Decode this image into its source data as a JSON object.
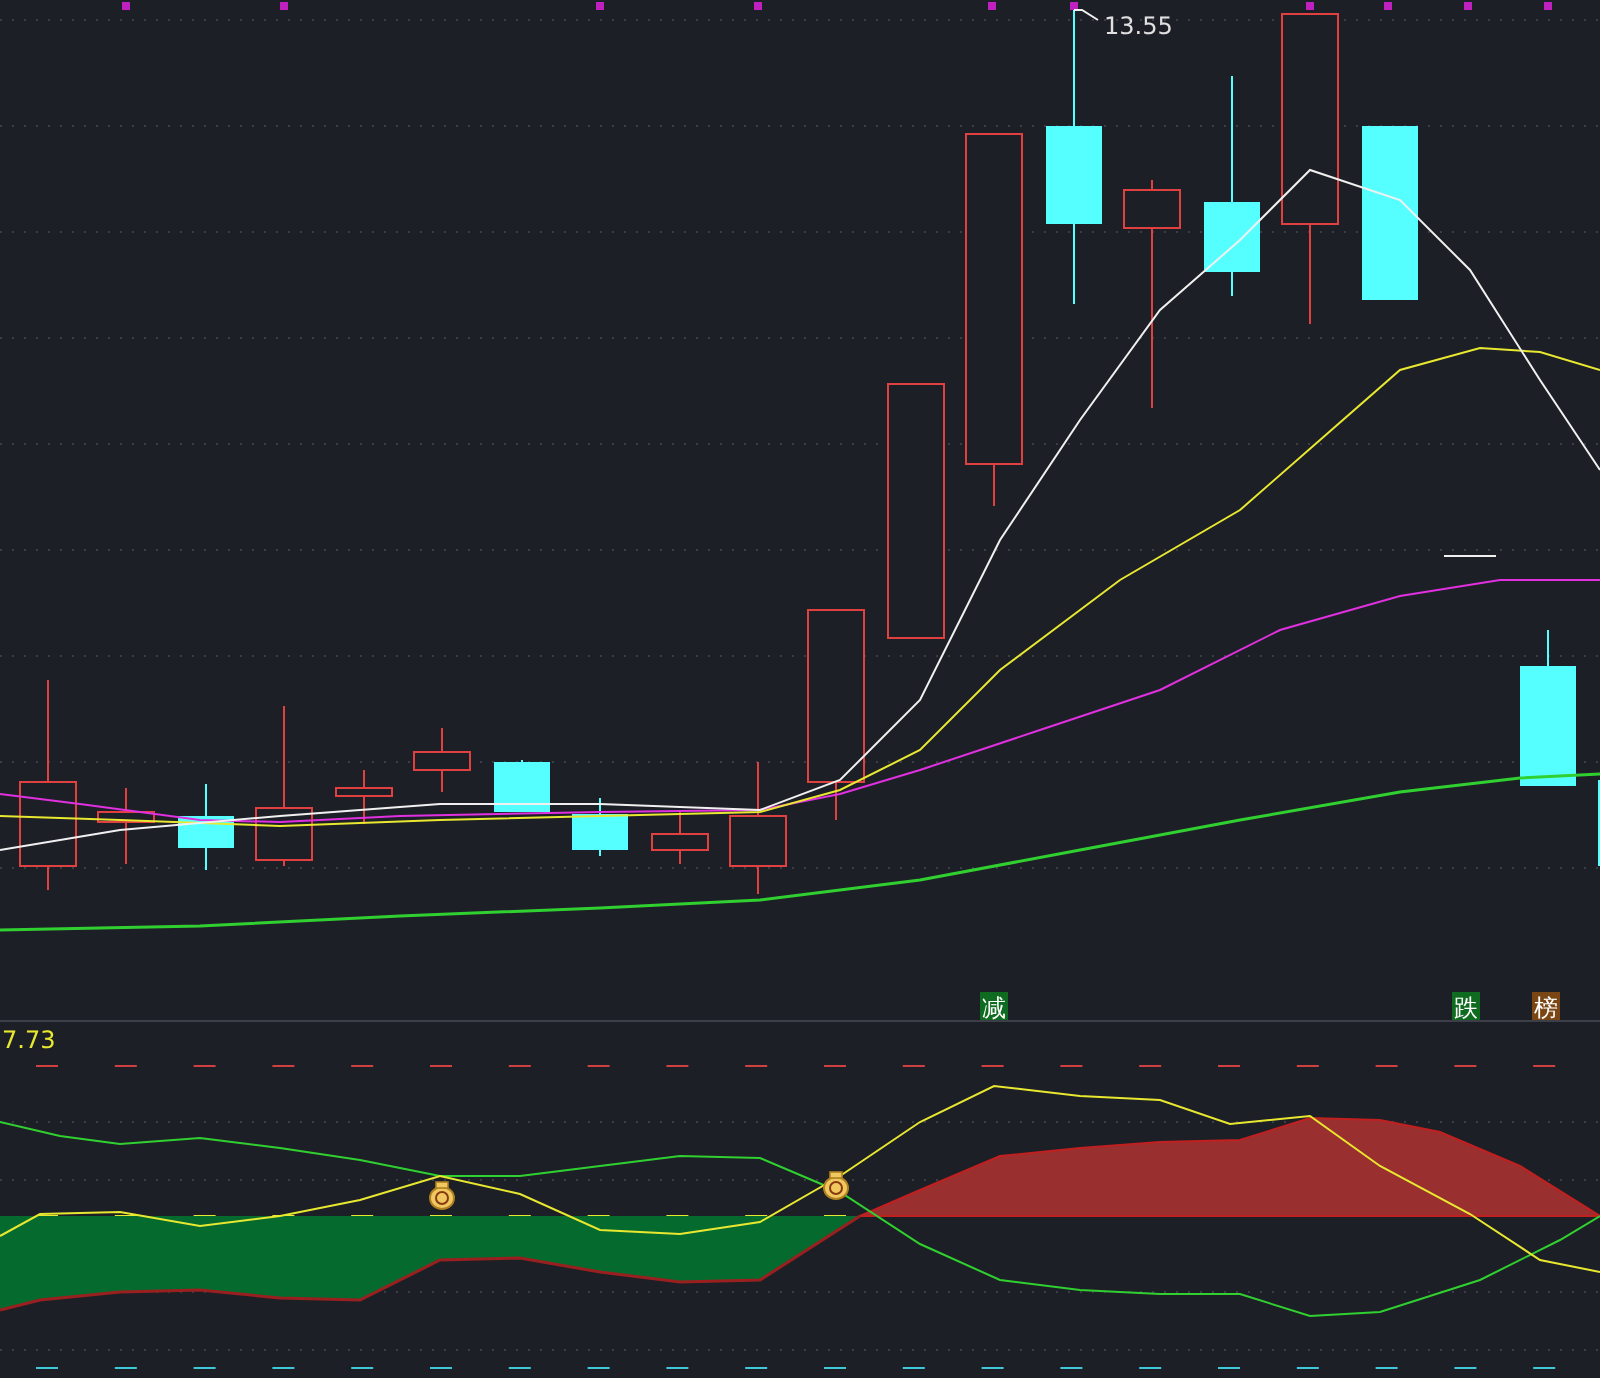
{
  "price_panel": {
    "high_label": "13.55",
    "signals": [
      {
        "label": "减",
        "color": "#0f6b1f"
      },
      {
        "label": "跌",
        "color": "#0f6b1f"
      },
      {
        "label": "榜",
        "color": "#7a4614"
      }
    ]
  },
  "indicator_panel": {
    "value": "7.73"
  }
}
